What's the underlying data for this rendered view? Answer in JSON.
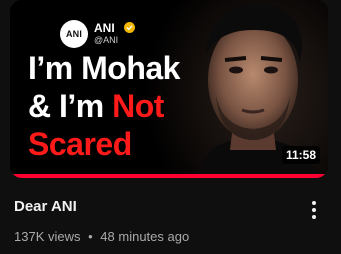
{
  "video": {
    "title": "Dear ANI",
    "views": "137K views",
    "separator": "•",
    "age": "48 minutes ago",
    "duration": "11:58",
    "watched_fraction": 1.0
  },
  "thumbnail": {
    "channel_logo_text": "ANI",
    "channel_name": "ANI",
    "channel_handle": "@ANI",
    "headline": {
      "line1": "I’m Mohak",
      "line2_white": "& I’m ",
      "line2_red": "Not",
      "line3": "Scared"
    }
  },
  "colors": {
    "background": "#0f0f0f",
    "headline_red": "#ff1a1a",
    "progress": "#ff0033",
    "verified_badge": "#f2b705"
  },
  "icons": {
    "verified": "verified-badge-icon",
    "menu": "more-vert-icon"
  }
}
